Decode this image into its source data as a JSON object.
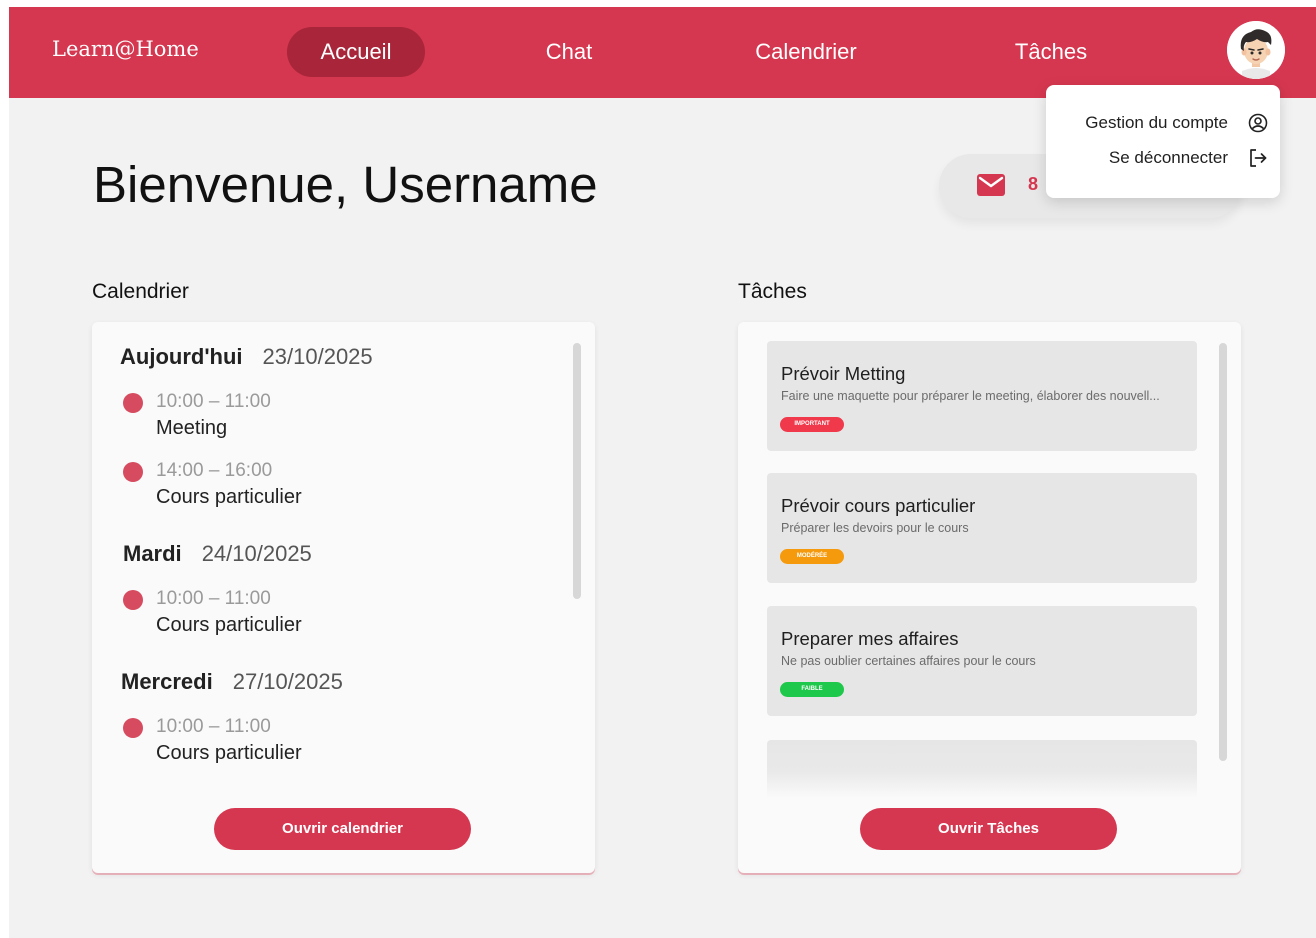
{
  "nav": {
    "logo": "Learn@Home",
    "items": [
      {
        "label": "Accueil",
        "active": true
      },
      {
        "label": "Chat",
        "active": false
      },
      {
        "label": "Calendrier",
        "active": false
      },
      {
        "label": "Tâches",
        "active": false
      }
    ]
  },
  "account_menu": {
    "items": [
      {
        "label": "Gestion du compte",
        "icon": "user-circle-icon"
      },
      {
        "label": "Se déconnecter",
        "icon": "logout-icon"
      }
    ]
  },
  "welcome": {
    "greeting": "Bienvenue,",
    "username": "Username"
  },
  "messages": {
    "count_visible": "8",
    "icon": "mail-icon"
  },
  "calendar": {
    "section_title": "Calendrier",
    "days": [
      {
        "day": "Aujourd'hui",
        "date": "23/10/2025",
        "events": [
          {
            "time": "10:00 – 11:00",
            "title": "Meeting"
          },
          {
            "time": "14:00 – 16:00",
            "title": "Cours particulier"
          }
        ]
      },
      {
        "day": "Mardi",
        "date": "24/10/2025",
        "events": [
          {
            "time": "10:00 – 11:00",
            "title": "Cours particulier"
          }
        ]
      },
      {
        "day": "Mercredi",
        "date": "27/10/2025",
        "events": [
          {
            "time": "10:00 – 11:00",
            "title": "Cours particulier"
          }
        ]
      }
    ],
    "button_label": "Ouvrir calendrier"
  },
  "tasks": {
    "section_title": "Tâches",
    "items": [
      {
        "title": "Prévoir Metting",
        "description": "Faire une maquette pour préparer le meeting, élaborer des nouvell...",
        "priority": "Important",
        "color": "#f0394a"
      },
      {
        "title": "Prévoir cours particulier",
        "description": "Préparer les devoirs pour le cours",
        "priority": "Modérée",
        "color": "#f59a0c"
      },
      {
        "title": "Preparer mes affaires",
        "description": "Ne pas oublier certaines affaires pour le cours",
        "priority": "Faible",
        "color": "#1ec84a"
      }
    ],
    "button_label": "Ouvrir Tâches"
  },
  "colors": {
    "brand": "#d63750",
    "brand_dark": "#a8253a",
    "background": "#f2f2f2"
  }
}
